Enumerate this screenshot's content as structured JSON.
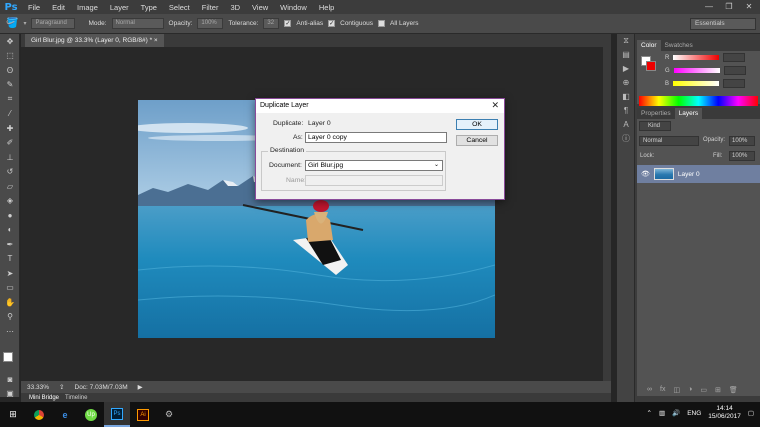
{
  "app": {
    "logo": "Ps"
  },
  "menu": [
    "File",
    "Edit",
    "Image",
    "Layer",
    "Type",
    "Select",
    "Filter",
    "3D",
    "View",
    "Window",
    "Help"
  ],
  "options": {
    "sample_select": "Paragraund",
    "mode_label": "Mode:",
    "mode_value": "Normal",
    "opacity_label": "Opacity:",
    "opacity_value": "100%",
    "tolerance_label": "Tolerance:",
    "tolerance_value": "32",
    "antialias_label": "Anti-alias",
    "contiguous_label": "Contiguous",
    "all_layers_label": "All Layers",
    "workspace": "Essentials"
  },
  "document": {
    "tab": "Girl Blur.jpg @ 33.3% (Layer 0, RGB/8#) * ×"
  },
  "status": {
    "zoom": "33.33%",
    "doc": "Doc: 7.03M/7.03M"
  },
  "bottom_tabs": [
    "Mini Bridge",
    "Timeline"
  ],
  "color_panel": {
    "tabs": [
      "Color",
      "Swatches"
    ],
    "channels": [
      {
        "label": "R",
        "gradient": "#e00000"
      },
      {
        "label": "G",
        "gradient": "#c000c0"
      },
      {
        "label": "B",
        "gradient": "#c0c000"
      }
    ]
  },
  "layers_panel": {
    "tabs": [
      "Properties",
      "Layers"
    ],
    "kind": "Kind",
    "blend": "Normal",
    "opacity_label": "Opacity:",
    "opacity_value": "100%",
    "lock_label": "Lock:",
    "fill_label": "Fill:",
    "fill_value": "100%",
    "layer_name": "Layer 0"
  },
  "dialog": {
    "title": "Duplicate Layer",
    "duplicate_label": "Duplicate:",
    "duplicate_value": "Layer 0",
    "as_label": "As:",
    "as_value": "Layer 0 copy",
    "ok": "OK",
    "cancel": "Cancel",
    "destination": "Destination",
    "document_label": "Document:",
    "document_value": "Girl Blur.jpg",
    "name_label": "Name:"
  },
  "taskbar": {
    "language": "ENG",
    "time": "14:14",
    "date": "15/06/2017"
  }
}
